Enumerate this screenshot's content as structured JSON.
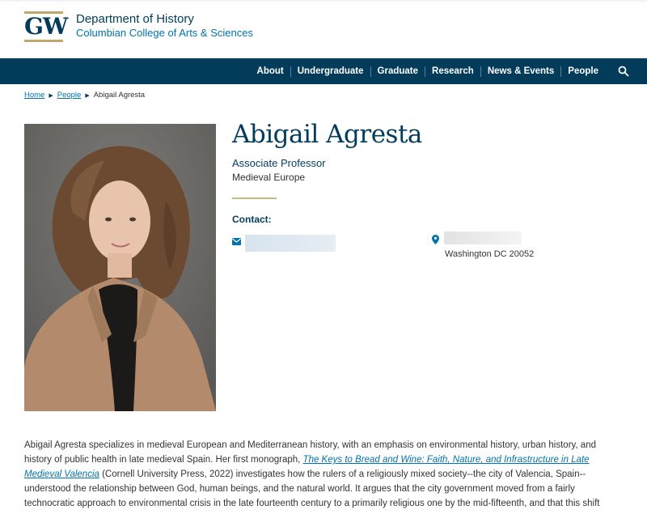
{
  "header": {
    "logo_text": "GW",
    "department": "Department of History",
    "college": "Columbian College of Arts & Sciences"
  },
  "nav": {
    "items": [
      "About",
      "Undergraduate",
      "Graduate",
      "Research",
      "News & Events",
      "People"
    ],
    "search_icon": "search-icon"
  },
  "breadcrumb": {
    "home": "Home",
    "people": "People",
    "current": "Abigail Agresta"
  },
  "profile": {
    "name": "Abigail Agresta",
    "title": "Associate Professor",
    "field": "Medieval Europe",
    "contact_label": "Contact:",
    "address_city": "Washington DC 20052"
  },
  "bio": {
    "part1": "Abigail Agresta specializes in medieval European and Mediterranean history, with an emphasis on environmental history, urban history, and history of public health in late medieval Spain. Her first monograph, ",
    "book_title": "The Keys to Bread and Wine: Faith, Nature, and Infrastructure in Late Medieval Valencia",
    "part2": " (Cornell University Press, 2022) investigates how the rulers of a religiously mixed society--the city of Valencia, Spain--understood the relationship between God, human beings, and the natural world. It argues that the city government moved from a fairly technocratic approach to environmental crisis in the late fourteenth century to a primarily religious one by the mid-fifteenth, and that this shift"
  },
  "colors": {
    "navy": "#033c5a",
    "link": "#0073aa",
    "gold": "#c4a66d"
  }
}
